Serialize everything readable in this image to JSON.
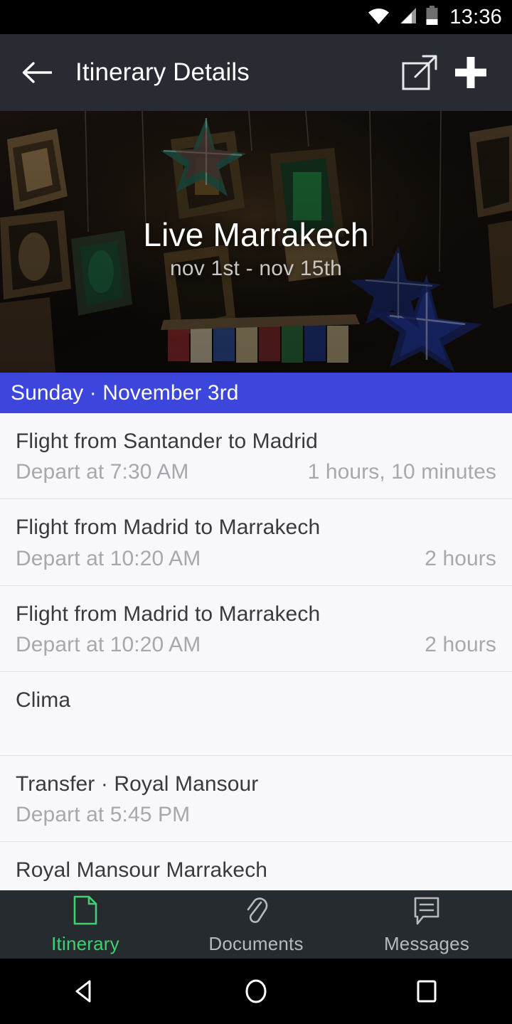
{
  "statusbar": {
    "time": "13:36",
    "icons": [
      "wifi-icon",
      "cellular-signal-icon",
      "battery-icon"
    ]
  },
  "appbar": {
    "back_icon": "arrow-left-icon",
    "title": "Itinerary Details",
    "share_icon": "open-external-icon",
    "add_icon": "plus-icon"
  },
  "hero": {
    "title": "Live Marrakech",
    "subtitle": "nov 1st - nov 15th",
    "image_description": "moroccan-lanterns-market"
  },
  "day_header": {
    "label": "Sunday · November 3rd",
    "background": "#3C46DC"
  },
  "itinerary": {
    "items": [
      {
        "title": "Flight from Santander to Madrid",
        "subtitle": "Depart at 7:30 AM",
        "duration": "1 hours, 10 minutes"
      },
      {
        "title": "Flight from Madrid to Marrakech",
        "subtitle": "Depart at 10:20 AM",
        "duration": "2 hours"
      },
      {
        "title": "Flight from Madrid to Marrakech",
        "subtitle": "Depart at 10:20 AM",
        "duration": "2 hours"
      },
      {
        "title": "Clima",
        "subtitle": "",
        "duration": ""
      },
      {
        "title": "Transfer · Royal Mansour",
        "subtitle": "Depart at 5:45 PM",
        "duration": ""
      },
      {
        "title": "Royal Mansour Marrakech",
        "subtitle": "",
        "duration": ""
      }
    ]
  },
  "bottomnav": {
    "active_color": "#3FD171",
    "inactive_color": "#B7B9BB",
    "items": [
      {
        "label": "Itinerary",
        "icon": "document-icon",
        "active": true
      },
      {
        "label": "Documents",
        "icon": "paperclip-icon",
        "active": false
      },
      {
        "label": "Messages",
        "icon": "chat-bubble-icon",
        "active": false
      }
    ]
  },
  "androidnav": {
    "back": "triangle-back-icon",
    "home": "circle-home-icon",
    "recents": "square-recents-icon"
  }
}
